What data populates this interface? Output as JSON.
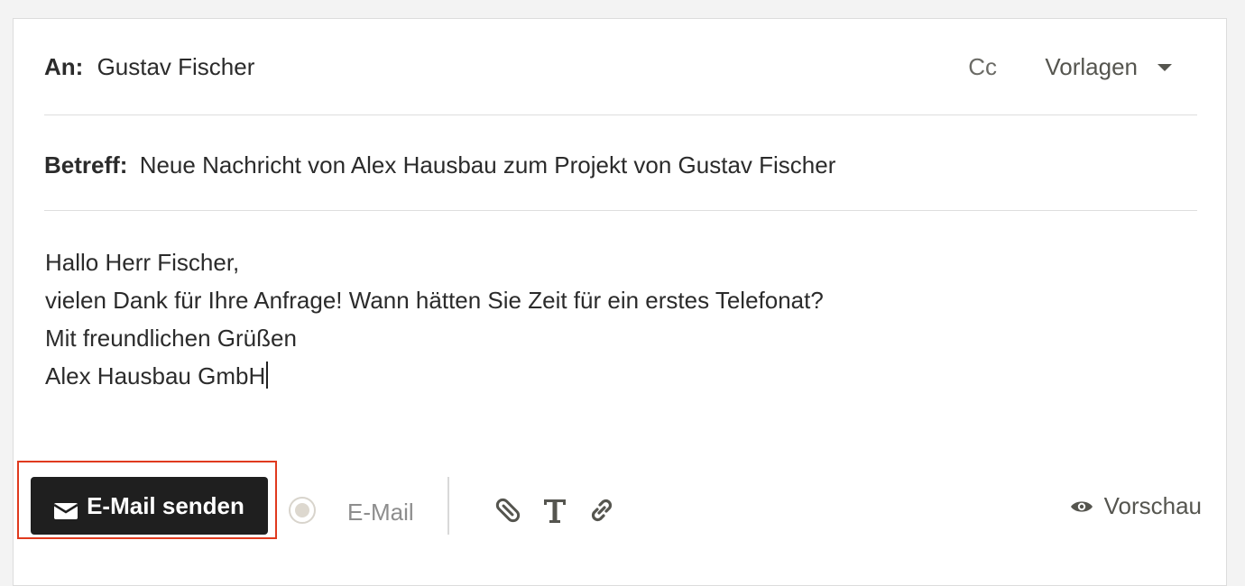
{
  "header": {
    "to_label": "An:",
    "to_value": "Gustav Fischer",
    "cc_label": "Cc",
    "templates_label": "Vorlagen"
  },
  "subject": {
    "label": "Betreff:",
    "value": "Neue Nachricht von Alex Hausbau zum Projekt von Gustav Fischer"
  },
  "body": {
    "lines": [
      "Hallo Herr Fischer,",
      "",
      "vielen Dank für Ihre Anfrage! Wann hätten Sie Zeit für ein erstes Telefonat?",
      "",
      "Mit freundlichen Grüßen",
      "Alex Hausbau GmbH"
    ]
  },
  "toolbar": {
    "send_label": "E-Mail senden",
    "channel_label": "E-Mail",
    "preview_label": "Vorschau",
    "icons": [
      "envelope-icon",
      "paperclip-icon",
      "text-format-icon",
      "link-icon",
      "eye-icon"
    ]
  },
  "colors": {
    "send_button_bg": "#1f1f1f",
    "highlight_border": "#e03a1e"
  }
}
